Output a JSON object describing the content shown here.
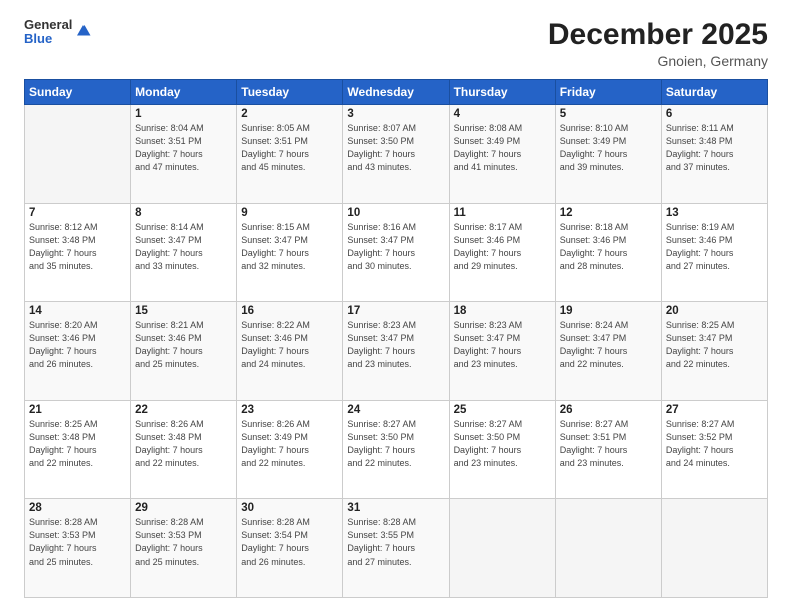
{
  "header": {
    "logo": {
      "general": "General",
      "blue": "Blue"
    },
    "title": "December 2025",
    "location": "Gnoien, Germany"
  },
  "days_of_week": [
    "Sunday",
    "Monday",
    "Tuesday",
    "Wednesday",
    "Thursday",
    "Friday",
    "Saturday"
  ],
  "weeks": [
    [
      {
        "num": "",
        "info": ""
      },
      {
        "num": "1",
        "info": "Sunrise: 8:04 AM\nSunset: 3:51 PM\nDaylight: 7 hours\nand 47 minutes."
      },
      {
        "num": "2",
        "info": "Sunrise: 8:05 AM\nSunset: 3:51 PM\nDaylight: 7 hours\nand 45 minutes."
      },
      {
        "num": "3",
        "info": "Sunrise: 8:07 AM\nSunset: 3:50 PM\nDaylight: 7 hours\nand 43 minutes."
      },
      {
        "num": "4",
        "info": "Sunrise: 8:08 AM\nSunset: 3:49 PM\nDaylight: 7 hours\nand 41 minutes."
      },
      {
        "num": "5",
        "info": "Sunrise: 8:10 AM\nSunset: 3:49 PM\nDaylight: 7 hours\nand 39 minutes."
      },
      {
        "num": "6",
        "info": "Sunrise: 8:11 AM\nSunset: 3:48 PM\nDaylight: 7 hours\nand 37 minutes."
      }
    ],
    [
      {
        "num": "7",
        "info": "Sunrise: 8:12 AM\nSunset: 3:48 PM\nDaylight: 7 hours\nand 35 minutes."
      },
      {
        "num": "8",
        "info": "Sunrise: 8:14 AM\nSunset: 3:47 PM\nDaylight: 7 hours\nand 33 minutes."
      },
      {
        "num": "9",
        "info": "Sunrise: 8:15 AM\nSunset: 3:47 PM\nDaylight: 7 hours\nand 32 minutes."
      },
      {
        "num": "10",
        "info": "Sunrise: 8:16 AM\nSunset: 3:47 PM\nDaylight: 7 hours\nand 30 minutes."
      },
      {
        "num": "11",
        "info": "Sunrise: 8:17 AM\nSunset: 3:46 PM\nDaylight: 7 hours\nand 29 minutes."
      },
      {
        "num": "12",
        "info": "Sunrise: 8:18 AM\nSunset: 3:46 PM\nDaylight: 7 hours\nand 28 minutes."
      },
      {
        "num": "13",
        "info": "Sunrise: 8:19 AM\nSunset: 3:46 PM\nDaylight: 7 hours\nand 27 minutes."
      }
    ],
    [
      {
        "num": "14",
        "info": "Sunrise: 8:20 AM\nSunset: 3:46 PM\nDaylight: 7 hours\nand 26 minutes."
      },
      {
        "num": "15",
        "info": "Sunrise: 8:21 AM\nSunset: 3:46 PM\nDaylight: 7 hours\nand 25 minutes."
      },
      {
        "num": "16",
        "info": "Sunrise: 8:22 AM\nSunset: 3:46 PM\nDaylight: 7 hours\nand 24 minutes."
      },
      {
        "num": "17",
        "info": "Sunrise: 8:23 AM\nSunset: 3:47 PM\nDaylight: 7 hours\nand 23 minutes."
      },
      {
        "num": "18",
        "info": "Sunrise: 8:23 AM\nSunset: 3:47 PM\nDaylight: 7 hours\nand 23 minutes."
      },
      {
        "num": "19",
        "info": "Sunrise: 8:24 AM\nSunset: 3:47 PM\nDaylight: 7 hours\nand 22 minutes."
      },
      {
        "num": "20",
        "info": "Sunrise: 8:25 AM\nSunset: 3:47 PM\nDaylight: 7 hours\nand 22 minutes."
      }
    ],
    [
      {
        "num": "21",
        "info": "Sunrise: 8:25 AM\nSunset: 3:48 PM\nDaylight: 7 hours\nand 22 minutes."
      },
      {
        "num": "22",
        "info": "Sunrise: 8:26 AM\nSunset: 3:48 PM\nDaylight: 7 hours\nand 22 minutes."
      },
      {
        "num": "23",
        "info": "Sunrise: 8:26 AM\nSunset: 3:49 PM\nDaylight: 7 hours\nand 22 minutes."
      },
      {
        "num": "24",
        "info": "Sunrise: 8:27 AM\nSunset: 3:50 PM\nDaylight: 7 hours\nand 22 minutes."
      },
      {
        "num": "25",
        "info": "Sunrise: 8:27 AM\nSunset: 3:50 PM\nDaylight: 7 hours\nand 23 minutes."
      },
      {
        "num": "26",
        "info": "Sunrise: 8:27 AM\nSunset: 3:51 PM\nDaylight: 7 hours\nand 23 minutes."
      },
      {
        "num": "27",
        "info": "Sunrise: 8:27 AM\nSunset: 3:52 PM\nDaylight: 7 hours\nand 24 minutes."
      }
    ],
    [
      {
        "num": "28",
        "info": "Sunrise: 8:28 AM\nSunset: 3:53 PM\nDaylight: 7 hours\nand 25 minutes."
      },
      {
        "num": "29",
        "info": "Sunrise: 8:28 AM\nSunset: 3:53 PM\nDaylight: 7 hours\nand 25 minutes."
      },
      {
        "num": "30",
        "info": "Sunrise: 8:28 AM\nSunset: 3:54 PM\nDaylight: 7 hours\nand 26 minutes."
      },
      {
        "num": "31",
        "info": "Sunrise: 8:28 AM\nSunset: 3:55 PM\nDaylight: 7 hours\nand 27 minutes."
      },
      {
        "num": "",
        "info": ""
      },
      {
        "num": "",
        "info": ""
      },
      {
        "num": "",
        "info": ""
      }
    ]
  ]
}
